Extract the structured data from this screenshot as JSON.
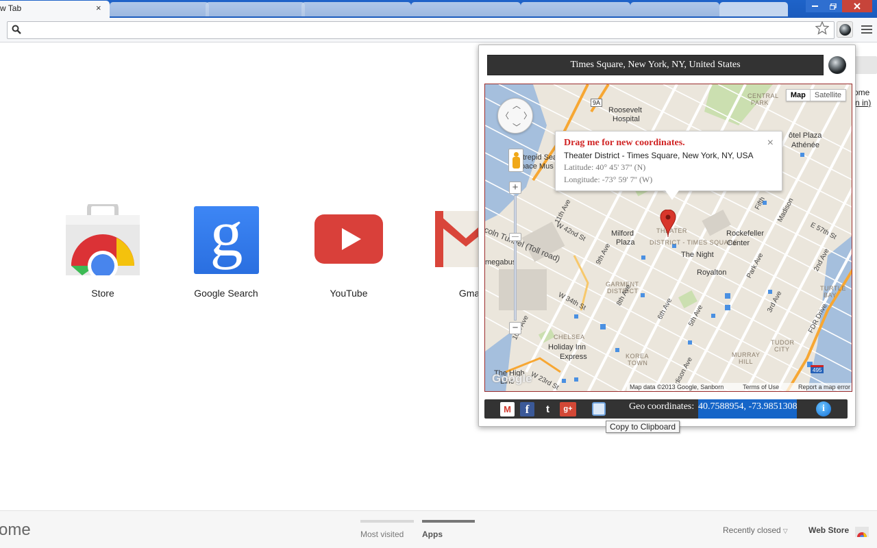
{
  "browser": {
    "active_tab_title": "w Tab",
    "tab_close": "×",
    "background_tabs": [
      "",
      "",
      "",
      "",
      "",
      "",
      ""
    ]
  },
  "toolbar": {
    "search_icon": "search-icon",
    "star_icon": "★",
    "omnibox_value": ""
  },
  "apps": [
    {
      "label": "Store",
      "icon": "chrome-web-store-icon"
    },
    {
      "label": "Google Search",
      "icon": "google-search-icon"
    },
    {
      "label": "YouTube",
      "icon": "youtube-icon"
    },
    {
      "label": "Gma",
      "icon": "gmail-icon"
    }
  ],
  "ntp_right": {
    "line1": "ome",
    "line2": "n in)"
  },
  "bottom_bar": {
    "brand_fragment": "ome",
    "tabs": [
      {
        "label": "Most visited"
      },
      {
        "label": "Apps"
      }
    ],
    "recently_closed": "Recently closed",
    "web_store": "Web Store"
  },
  "popup": {
    "address": "Times Square, New York, NY, United States",
    "map": {
      "type_map": "Map",
      "type_satellite": "Satellite",
      "info_window": {
        "title": "Drag me for new coordinates.",
        "address": "Theater District - Times Square, New York, NY, USA",
        "latitude": "Latitude: 40° 45' 37'' (N)",
        "longitude": "Longitude: -73° 59' 7'' (W)",
        "close": "×"
      },
      "labels": {
        "roosevelt": "Roosevelt",
        "hospital": "Hospital",
        "milford": "Milford",
        "plaza": "Plaza",
        "theater": "THEATER",
        "district_ts": "DISTRICT - TIMES SQUARE",
        "the_night": "The Night",
        "royalton": "Royalton",
        "rockefeller": "Rockefeller",
        "center": "Center",
        "garment": "GARMENT",
        "district": "DISTRICT",
        "chelsea": "CHELSEA",
        "holiday_inn": "Holiday Inn",
        "express": "Express",
        "korea": "KOREA",
        "town": "TOWN",
        "murray": "MURRAY",
        "hill": "HILL",
        "tudor": "TUDOR",
        "city": "CITY",
        "turtle": "TURTLE",
        "bay": "BAY",
        "central": "CENTRAL",
        "park": "PARK",
        "hotel_plaza": "ôtel Plaza",
        "athenee": "Athénée",
        "intrepid": "trepid Sea",
        "space": "pace Mus",
        "lincoln": "coln Tunnel (Toll road)",
        "megabus": "megabus",
        "the_high": "The High",
        "line": "Line",
        "fdr": "FDR Drive",
        "w42": "W 42nd St",
        "w34": "W 34th St",
        "w23": "W 23rd St",
        "e57": "E 57th St",
        "ave11": "11th Ave",
        "ave10": "10th Ave",
        "ave9": "9th Ave",
        "ave8": "8th Ave",
        "ave7": "7th Ave",
        "ave6": "6th Ave",
        "ave5": "5th Ave",
        "madison": "Madison",
        "park_ave": "Park Ave",
        "lex": "3rd Ave",
        "ave2": "2nd Ave",
        "fifth": "Fifth",
        "mad_lower": "dison Ave",
        "sign_9a": "9A",
        "sign_495": "495"
      },
      "attribution": "Map data ©2013 Google, Sanborn",
      "terms": "Terms of Use",
      "report": "Report a map error",
      "google": "Google"
    },
    "share_bar": {
      "gmail": "M",
      "facebook": "f",
      "twitter": "t",
      "gplus": "g+",
      "geo_label": "Geo coordinates:",
      "geo_value": "40.7588954, -73.9851308",
      "info": "i"
    },
    "tooltip": "Copy to Clipboard"
  },
  "colors": {
    "tab_strip": "#1e63c9",
    "map_land": "#ebe6dc",
    "map_water": "#a5bfdd",
    "highway": "#f7a733",
    "marker": "#d8362b",
    "geo_highlight": "#1565c8",
    "info_title": "#d02323"
  }
}
